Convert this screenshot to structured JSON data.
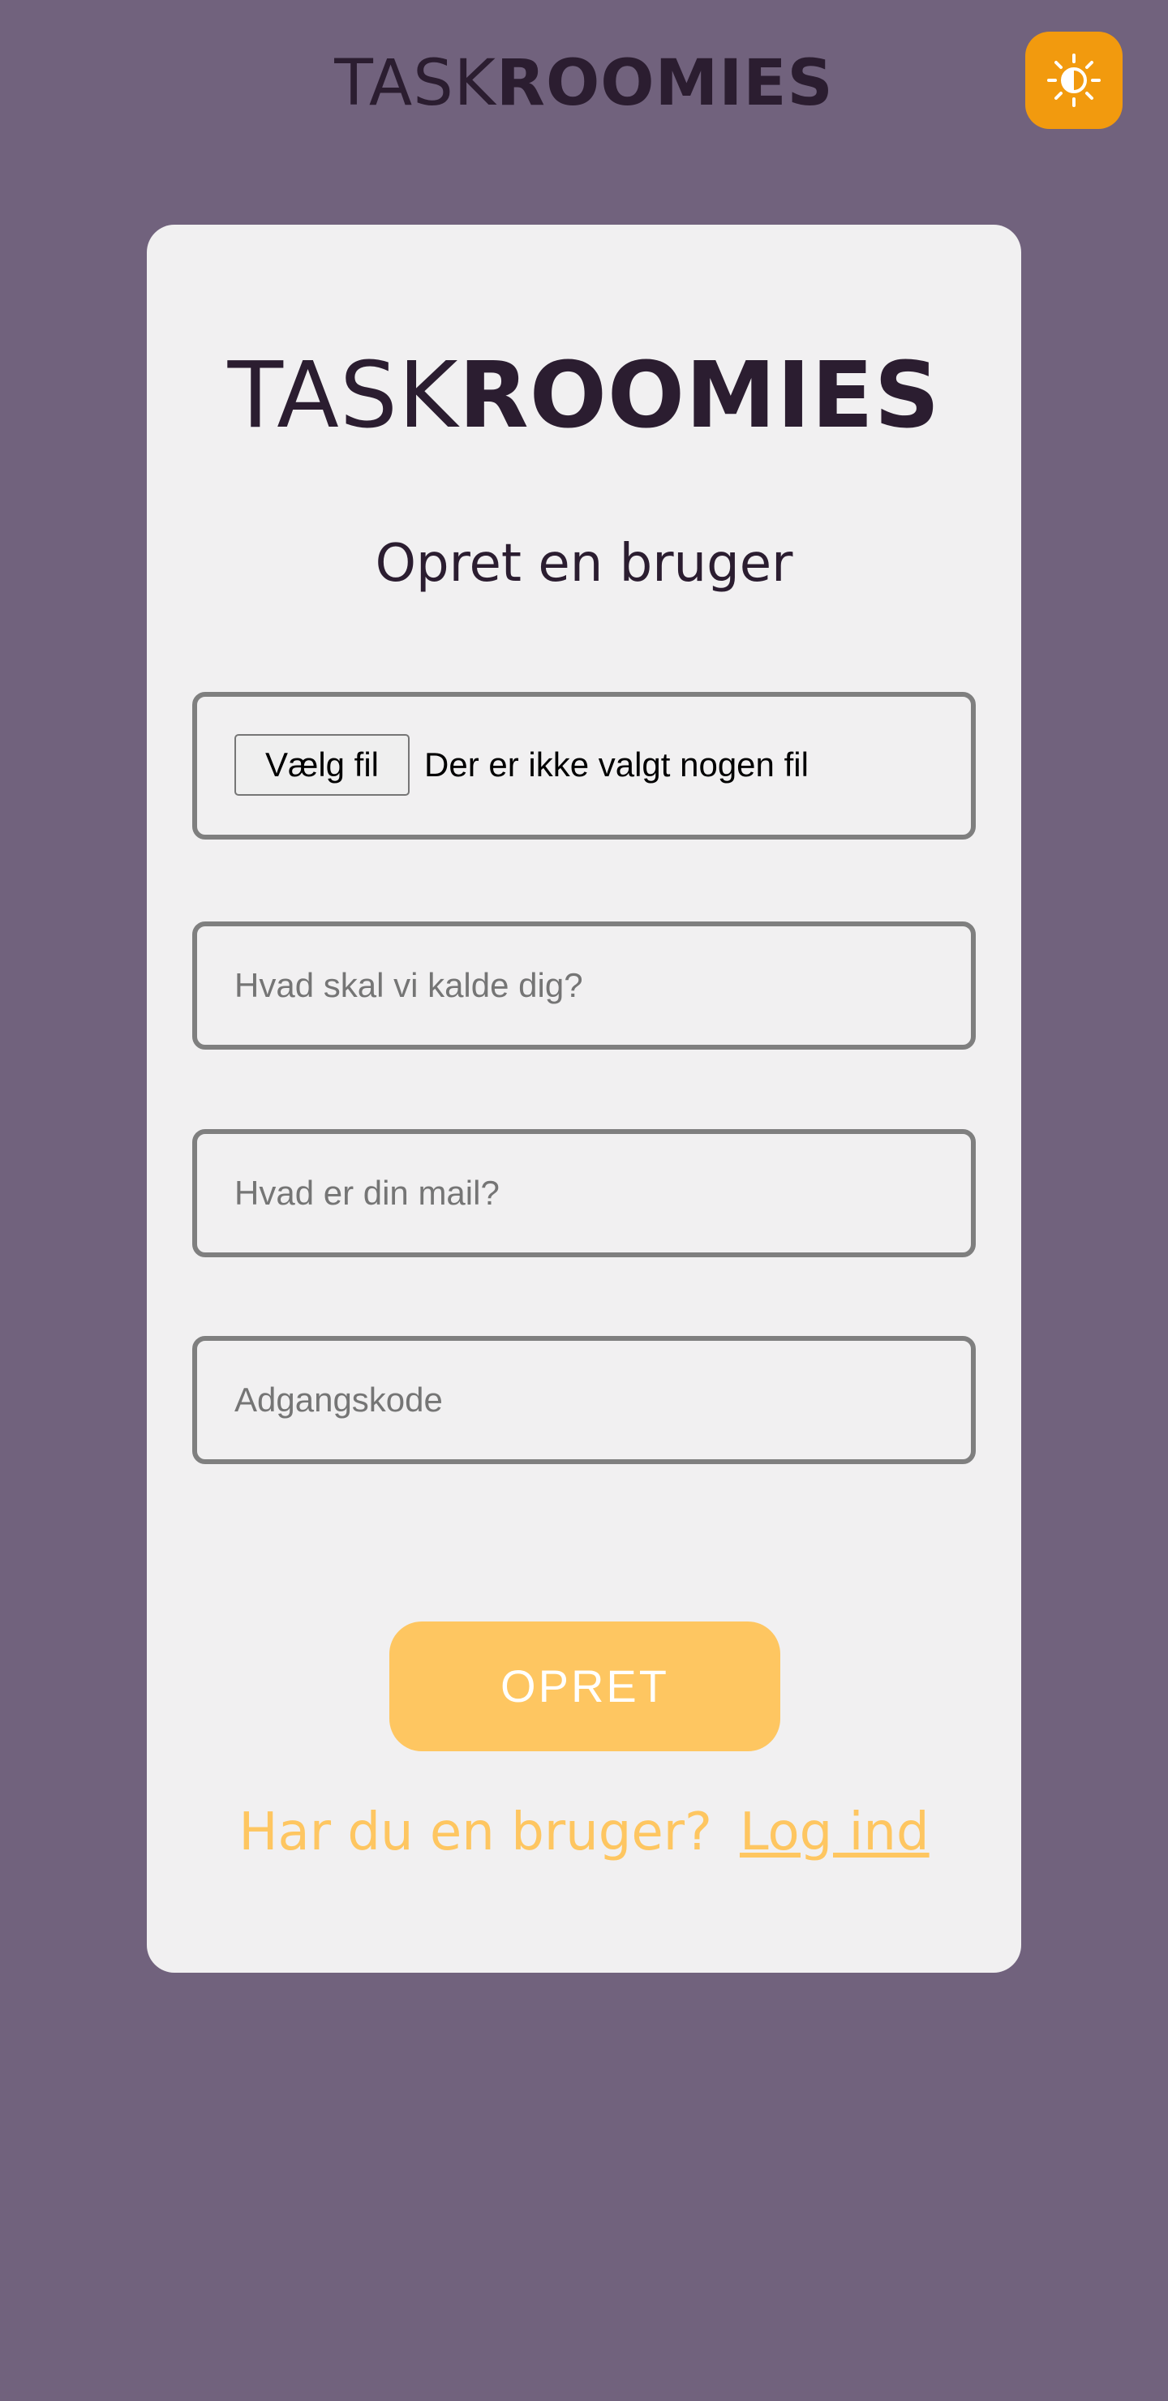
{
  "header": {
    "logo_light": "TASK",
    "logo_bold": "ROOMIES",
    "theme_toggle_icon": "sun-icon"
  },
  "card": {
    "logo_light": "TASK",
    "logo_bold": "ROOMIES",
    "title": "Opret en bruger",
    "file_input": {
      "button_label": "Vælg fil",
      "status": "Der er ikke valgt nogen fil"
    },
    "fields": {
      "name_placeholder": "Hvad skal vi kalde dig?",
      "email_placeholder": "Hvad er din mail?",
      "password_placeholder": "Adgangskode"
    },
    "submit_label": "OPRET",
    "login_prompt": "Har du en bruger?",
    "login_link": "Log ind"
  },
  "colors": {
    "background": "#71627d",
    "card": "#f1f0f1",
    "accent": "#fec661",
    "toggle": "#f29a0e",
    "text_dark": "#2b1d30"
  }
}
